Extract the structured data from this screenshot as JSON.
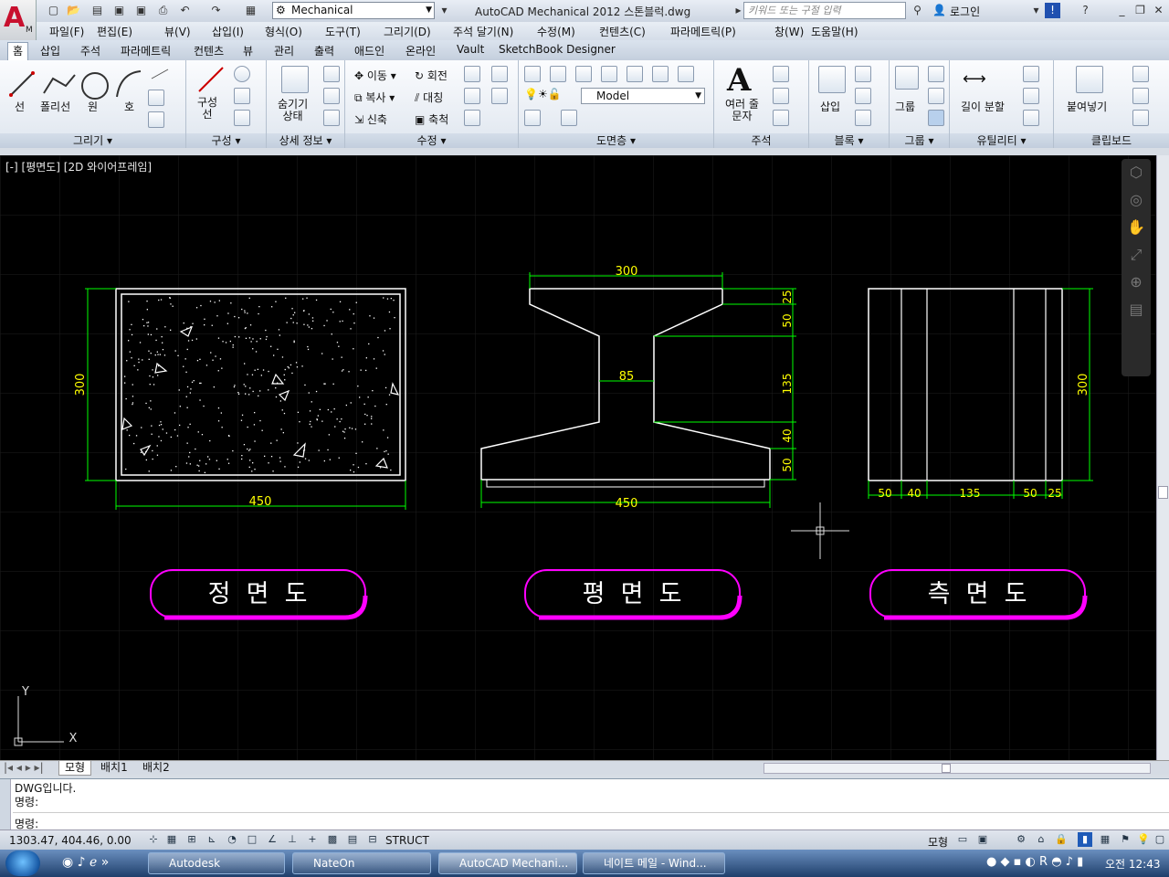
{
  "app": {
    "logo": "A",
    "logo_sub": "M",
    "workspace": "Mechanical",
    "title": "AutoCAD Mechanical 2012    스톤블럭.dwg",
    "search_placeholder": "키워드 또는 구절 입력",
    "login": "로그인"
  },
  "menus": [
    "파일(F)",
    "편집(E)",
    "뷰(V)",
    "삽입(I)",
    "형식(O)",
    "도구(T)",
    "그리기(D)",
    "주석 달기(N)",
    "수정(M)",
    "컨텐츠(C)",
    "파라메트릭(P)",
    "창(W)",
    "도움말(H)"
  ],
  "ribbon_tabs": [
    "홈",
    "삽입",
    "주석",
    "파라메트릭",
    "컨텐츠",
    "뷰",
    "관리",
    "출력",
    "애드인",
    "온라인",
    "Vault",
    "SketchBook Designer"
  ],
  "ribbon": {
    "draw": {
      "title": "그리기",
      "items": [
        "선",
        "폴리선",
        "원",
        "호"
      ]
    },
    "construct": {
      "title": "구성",
      "items": [
        "구성\n선"
      ]
    },
    "detail": {
      "title": "상세 정보",
      "items": [
        "숨기기\n상태"
      ]
    },
    "modify": {
      "title": "수정",
      "items": [
        "이동",
        "회전",
        "복사",
        "대칭",
        "신축",
        "축척"
      ]
    },
    "layers": {
      "title": "도면층",
      "model": "Model"
    },
    "annotation": {
      "title": "주석",
      "items": [
        "여러 줄\n문자"
      ]
    },
    "block": {
      "title": "블록",
      "items": [
        "삽입"
      ]
    },
    "group": {
      "title": "그룹",
      "items": [
        "그룹"
      ]
    },
    "utilities": {
      "title": "유틸리티",
      "items": [
        "길이 분할"
      ]
    },
    "clipboard": {
      "title": "클립보드",
      "items": [
        "붙여넣기"
      ]
    }
  },
  "viewport": {
    "label": "[-] [평면도] [2D 와이어프레임]",
    "ucs_x": "X",
    "ucs_y": "Y"
  },
  "drawing": {
    "front": {
      "dim_w": "450",
      "dim_h": "300",
      "caption": "정  면  도"
    },
    "plan": {
      "dim_top": "300",
      "dim_mid": "85",
      "dim_bottom": "450",
      "right_dims": [
        "25",
        "50",
        "135",
        "40",
        "50"
      ],
      "caption": "평  면  도"
    },
    "side": {
      "dim_h": "300",
      "bottom_dims": [
        "50",
        "40",
        "135",
        "50",
        "25"
      ],
      "caption": "측  면  도"
    }
  },
  "layout_tabs": [
    "모형",
    "배치1",
    "배치2"
  ],
  "command": {
    "lines": [
      "DWG입니다.",
      "명령:",
      "명령:"
    ]
  },
  "status": {
    "coords": "1303.47, 404.46, 0.00",
    "struct": "STRUCT",
    "model": "모형"
  },
  "taskbar": {
    "items": [
      "Autodesk",
      "NateOn",
      "AutoCAD Mechani...",
      "네이트 메일 - Wind..."
    ],
    "clock": "오전 12:43"
  },
  "colors": {
    "green": "#00ff00",
    "white": "#ffffff",
    "magenta": "#ff00ff",
    "yellow": "#ffff00"
  }
}
